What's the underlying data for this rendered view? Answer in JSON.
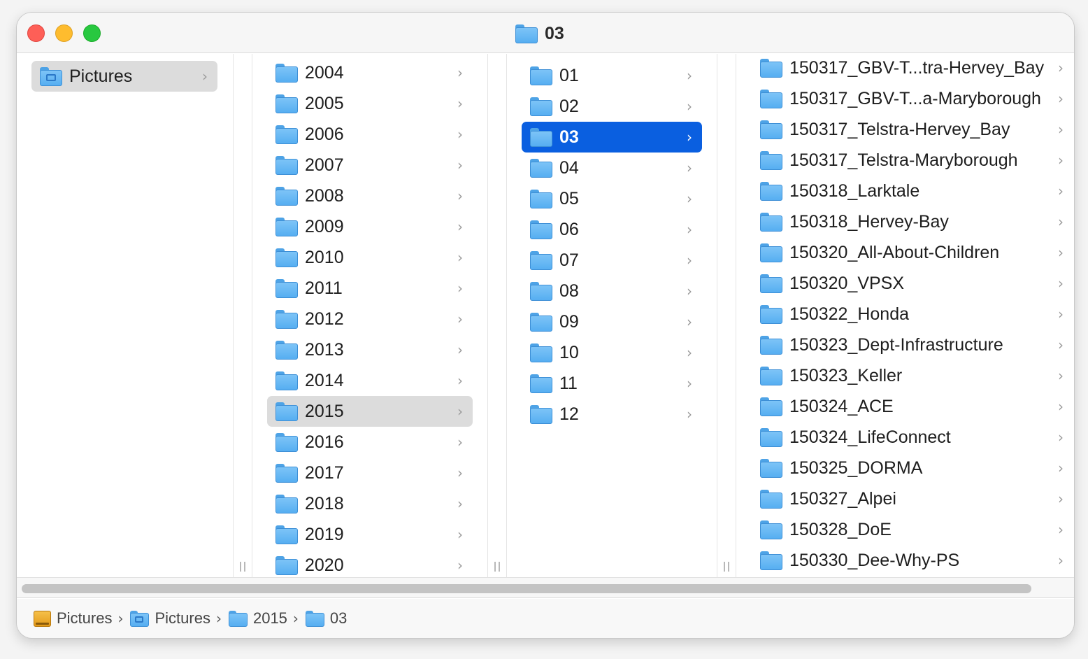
{
  "window": {
    "title": "03"
  },
  "columns": {
    "col1": [
      {
        "label": "Pictures",
        "icon": "pictures-folder-icon",
        "selected": "gray"
      }
    ],
    "col2": [
      {
        "label": "2004"
      },
      {
        "label": "2005"
      },
      {
        "label": "2006"
      },
      {
        "label": "2007"
      },
      {
        "label": "2008"
      },
      {
        "label": "2009"
      },
      {
        "label": "2010"
      },
      {
        "label": "2011"
      },
      {
        "label": "2012"
      },
      {
        "label": "2013"
      },
      {
        "label": "2014"
      },
      {
        "label": "2015",
        "selected": "gray"
      },
      {
        "label": "2016"
      },
      {
        "label": "2017"
      },
      {
        "label": "2018"
      },
      {
        "label": "2019"
      },
      {
        "label": "2020"
      }
    ],
    "col3": [
      {
        "label": "01"
      },
      {
        "label": "02"
      },
      {
        "label": "03",
        "selected": "blue"
      },
      {
        "label": "04"
      },
      {
        "label": "05"
      },
      {
        "label": "06"
      },
      {
        "label": "07"
      },
      {
        "label": "08"
      },
      {
        "label": "09"
      },
      {
        "label": "10"
      },
      {
        "label": "11"
      },
      {
        "label": "12"
      }
    ],
    "col4": [
      {
        "label": "150317_GBV-T...tra-Hervey_Bay"
      },
      {
        "label": "150317_GBV-T...a-Maryborough"
      },
      {
        "label": "150317_Telstra-Hervey_Bay"
      },
      {
        "label": "150317_Telstra-Maryborough"
      },
      {
        "label": "150318_Larktale"
      },
      {
        "label": "150318_Hervey-Bay"
      },
      {
        "label": "150320_All-About-Children"
      },
      {
        "label": "150320_VPSX"
      },
      {
        "label": "150322_Honda"
      },
      {
        "label": "150323_Dept-Infrastructure"
      },
      {
        "label": "150323_Keller"
      },
      {
        "label": "150324_ACE"
      },
      {
        "label": "150324_LifeConnect"
      },
      {
        "label": "150325_DORMA"
      },
      {
        "label": "150327_Alpei"
      },
      {
        "label": "150328_DoE"
      },
      {
        "label": "150330_Dee-Why-PS"
      }
    ]
  },
  "pathbar": [
    {
      "label": "Pictures",
      "icon": "drive-icon"
    },
    {
      "label": "Pictures",
      "icon": "pictures-folder-icon"
    },
    {
      "label": "2015",
      "icon": "folder-icon"
    },
    {
      "label": "03",
      "icon": "folder-icon"
    }
  ],
  "colors": {
    "selection_blue": "#0a5fe0",
    "selection_gray": "#dcdcdc",
    "folder_blue": "#56aef1"
  }
}
